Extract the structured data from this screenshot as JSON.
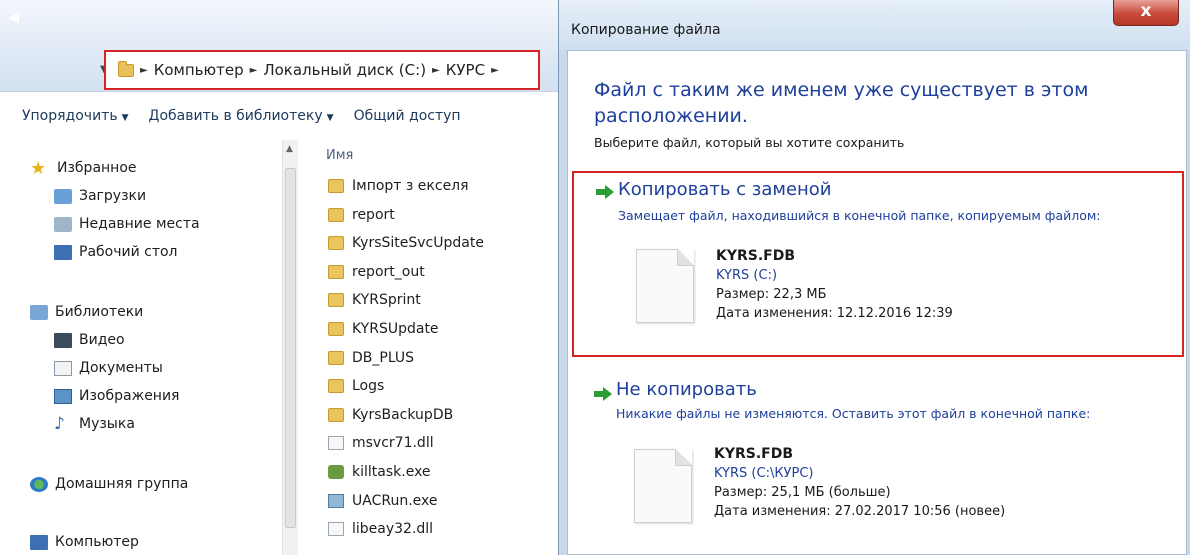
{
  "explorer": {
    "address": {
      "crumbs": [
        "Компьютер",
        "Локальный диск (C:)",
        "КУРС"
      ]
    },
    "toolbar": {
      "organize": "Упорядочить",
      "add_to_library": "Добавить в библиотеку",
      "share": "Общий доступ"
    },
    "nav": {
      "favorites": "Избранное",
      "downloads": "Загрузки",
      "recent": "Недавние места",
      "desktop": "Рабочий стол",
      "libraries": "Библиотеки",
      "video": "Видео",
      "documents": "Документы",
      "pictures": "Изображения",
      "music": "Музыка",
      "homegroup": "Домашняя группа",
      "computer": "Компьютер"
    },
    "file_list": {
      "column_name": "Имя",
      "files": [
        {
          "name": "Імпорт з екселя",
          "type": "folder"
        },
        {
          "name": "report",
          "type": "folder"
        },
        {
          "name": "KyrsSiteSvcUpdate",
          "type": "folder"
        },
        {
          "name": "report_out",
          "type": "folder"
        },
        {
          "name": "KYRSprint",
          "type": "folder"
        },
        {
          "name": "KYRSUpdate",
          "type": "folder"
        },
        {
          "name": "DB_PLUS",
          "type": "folder"
        },
        {
          "name": "Logs",
          "type": "folder"
        },
        {
          "name": "KyrsBackupDB",
          "type": "folder"
        },
        {
          "name": "msvcr71.dll",
          "type": "dll"
        },
        {
          "name": "killtask.exe",
          "type": "exe1"
        },
        {
          "name": "UACRun.exe",
          "type": "exe2"
        },
        {
          "name": "libeay32.dll",
          "type": "dll"
        }
      ]
    }
  },
  "dialog": {
    "title": "Копирование файла",
    "heading": "Файл с таким же именем уже существует в этом расположении.",
    "instruction": "Выберите файл, который вы хотите сохранить",
    "replace": {
      "title": "Копировать с заменой",
      "description": "Замещает файл, находившийся в конечной папке, копируемым файлом:",
      "file_name": "KYRS.FDB",
      "location": "KYRS (C:)",
      "size": "Размер: 22,3 МБ",
      "modified": "Дата изменения: 12.12.2016 12:39"
    },
    "skip": {
      "title": "Не копировать",
      "description": "Никакие файлы не изменяются. Оставить этот файл в конечной папке:",
      "file_name": "KYRS.FDB",
      "location": "KYRS (C:\\КУРС)",
      "size": "Размер: 25,1 МБ (больше)",
      "modified": "Дата изменения: 27.02.2017 10:56 (новее)"
    }
  }
}
